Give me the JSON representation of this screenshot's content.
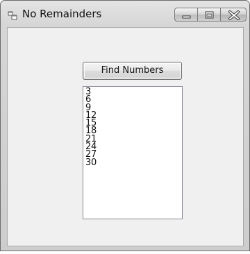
{
  "window": {
    "title": "No Remainders",
    "app_icon": "window-app-icon",
    "caption_buttons": [
      "minimize-icon",
      "maximize-icon",
      "close-icon"
    ]
  },
  "form": {
    "find_button_label": "Find Numbers",
    "results": [
      "3",
      "6",
      "9",
      "12",
      "15",
      "18",
      "21",
      "24",
      "27",
      "30"
    ]
  }
}
